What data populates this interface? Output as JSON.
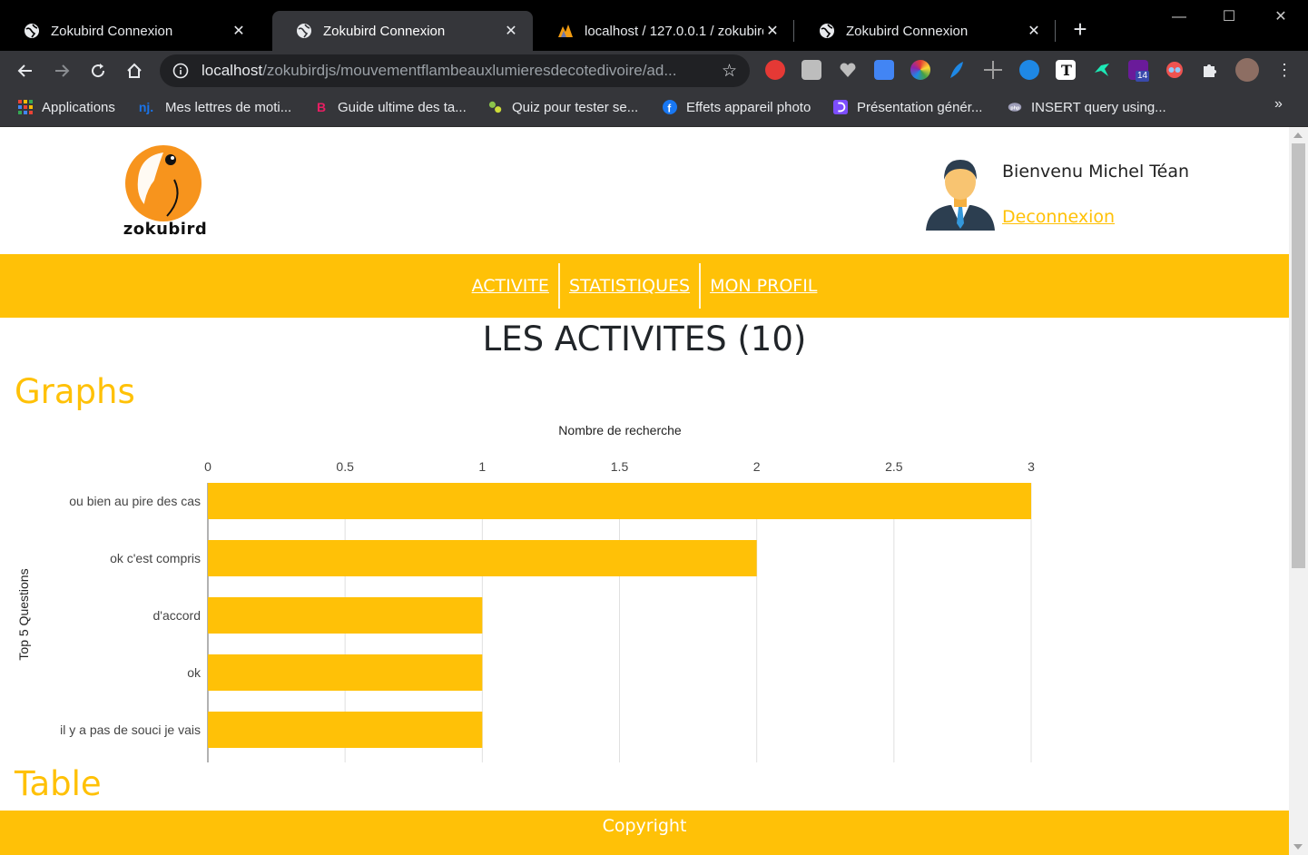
{
  "browser": {
    "tabs": [
      {
        "title": "Zokubird Connexion",
        "active": false
      },
      {
        "title": "Zokubird Connexion",
        "active": true
      },
      {
        "title": "localhost / 127.0.0.1 / zokubird",
        "active": false
      },
      {
        "title": "Zokubird Connexion",
        "active": false
      }
    ],
    "url_host": "localhost",
    "url_path": "/zokubirdjs/mouvementflambeauxlumieresdecotedivoire/ad...",
    "extension_badge": "14",
    "bookmarks": [
      {
        "label": "Applications",
        "icon": "apps-grid-icon",
        "color": "#e94235"
      },
      {
        "label": "Mes lettres de moti...",
        "icon": "nj-icon",
        "color": "#1a73e8"
      },
      {
        "label": "Guide ultime des ta...",
        "icon": "b-icon",
        "color": "#e91e63"
      },
      {
        "label": "Quiz pour tester se...",
        "icon": "leaf-icon",
        "color": "#8bc34a"
      },
      {
        "label": "Effets appareil photo",
        "icon": "facebook-icon",
        "color": "#1877f2"
      },
      {
        "label": "Présentation génér...",
        "icon": "d-icon",
        "color": "#7c4dff"
      },
      {
        "label": "INSERT query using...",
        "icon": "db-icon",
        "color": "#9e9eb8"
      }
    ]
  },
  "header": {
    "logo_text": "zokubird",
    "welcome": "Bienvenu Michel Téan",
    "logout": "Deconnexion"
  },
  "nav": {
    "items": [
      "ACTIVITE",
      "STATISTIQUES",
      "MON PROFIL"
    ]
  },
  "page": {
    "title": "LES ACTIVITES (10)",
    "graphs_heading": "Graphs",
    "table_heading": "Table",
    "footer": "Copyright"
  },
  "colors": {
    "accent": "#ffc107",
    "chrome_dark": "#202124",
    "text_dark": "#212529"
  },
  "chart_data": {
    "type": "bar",
    "orientation": "horizontal",
    "title": "Nombre de recherche",
    "xlabel": "Nombre de recherche",
    "ylabel": "Top 5 Questions",
    "categories": [
      "ou bien au pire des cas",
      "ok c'est compris",
      "d'accord",
      "ok",
      "il y a pas de souci je vais"
    ],
    "values": [
      3,
      2,
      1,
      1,
      1
    ],
    "xlim": [
      0,
      3
    ],
    "xticks": [
      0,
      0.5,
      1,
      1.5,
      2,
      2.5,
      3
    ],
    "xtick_labels": [
      "0",
      "0.5",
      "1",
      "1.5",
      "2",
      "2.5",
      "3"
    ],
    "grid": true,
    "bar_color": "#ffc107"
  }
}
